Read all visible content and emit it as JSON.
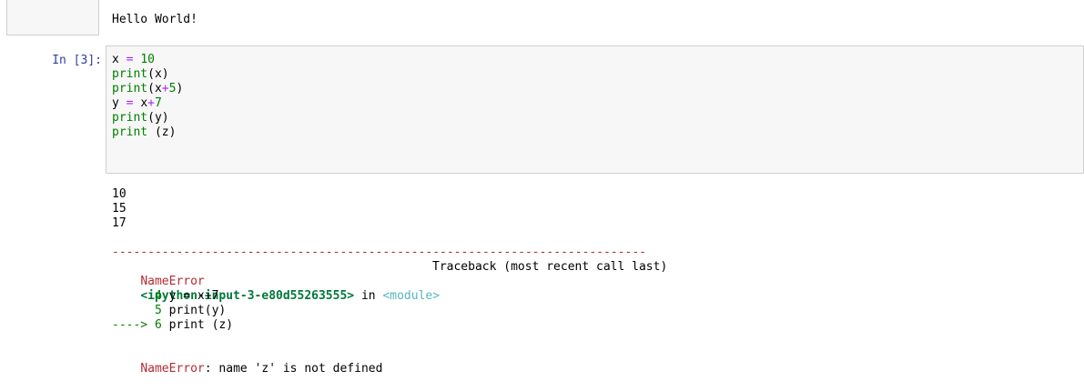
{
  "previous_cell": {
    "output_text": "Hello World!"
  },
  "cell": {
    "prompt": "In [3]:",
    "code_lines": [
      {
        "tokens": [
          {
            "t": "x",
            "c": "var"
          },
          {
            "t": " = ",
            "c": "op"
          },
          {
            "t": "10",
            "c": "num"
          }
        ]
      },
      {
        "tokens": [
          {
            "t": "print",
            "c": "fn"
          },
          {
            "t": "(x)",
            "c": "punc"
          }
        ]
      },
      {
        "tokens": [
          {
            "t": "print",
            "c": "fn"
          },
          {
            "t": "(x",
            "c": "punc"
          },
          {
            "t": "+",
            "c": "op"
          },
          {
            "t": "5",
            "c": "num"
          },
          {
            "t": ")",
            "c": "punc"
          }
        ]
      },
      {
        "tokens": [
          {
            "t": "y",
            "c": "var"
          },
          {
            "t": " = ",
            "c": "op"
          },
          {
            "t": "x",
            "c": "var"
          },
          {
            "t": "+",
            "c": "op"
          },
          {
            "t": "7",
            "c": "num"
          }
        ]
      },
      {
        "tokens": [
          {
            "t": "print",
            "c": "fn"
          },
          {
            "t": "(y)",
            "c": "punc"
          }
        ]
      },
      {
        "tokens": [
          {
            "t": "print",
            "c": "fn"
          },
          {
            "t": " (z)",
            "c": "punc"
          }
        ]
      }
    ]
  },
  "output": {
    "stdout_lines": [
      "10",
      "15",
      "17"
    ],
    "traceback": {
      "separator": "---------------------------------------------------------------------------",
      "error_name": "NameError",
      "header_right": "Traceback (most recent call last)",
      "location_file": "<ipython-input-3-e80d55263555>",
      "location_in": " in ",
      "location_module": "<module>",
      "lines": [
        {
          "prefix": "      ",
          "lineno": "4",
          "code": " y = x+7"
        },
        {
          "prefix": "      ",
          "lineno": "5",
          "code": " print(y)"
        },
        {
          "prefix": "----> ",
          "lineno": "6",
          "code": " print (z)"
        }
      ],
      "final_error_name": "NameError",
      "final_message": ": name 'z' is not defined"
    }
  }
}
